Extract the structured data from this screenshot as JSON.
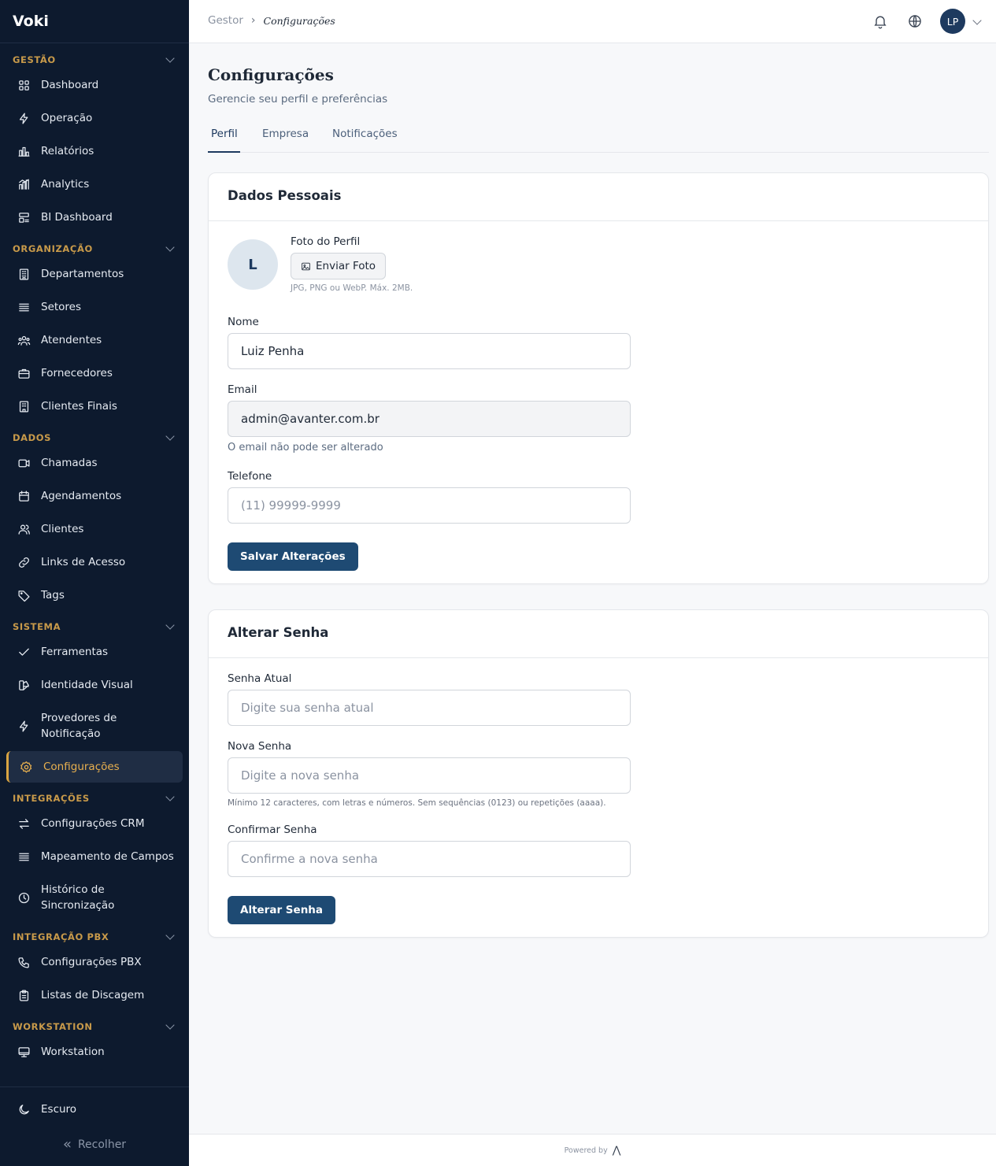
{
  "brand": "Voki",
  "sidebar": {
    "sections": [
      {
        "title": "GESTÃO",
        "items": [
          "Dashboard",
          "Operação",
          "Relatórios",
          "Analytics",
          "BI Dashboard"
        ]
      },
      {
        "title": "ORGANIZAÇÃO",
        "items": [
          "Departamentos",
          "Setores",
          "Atendentes",
          "Fornecedores",
          "Clientes Finais"
        ]
      },
      {
        "title": "DADOS",
        "items": [
          "Chamadas",
          "Agendamentos",
          "Clientes",
          "Links de Acesso",
          "Tags"
        ]
      },
      {
        "title": "SISTEMA",
        "items": [
          "Ferramentas",
          "Identidade Visual",
          "Provedores de Notificação",
          "Configurações"
        ]
      },
      {
        "title": "INTEGRAÇÕES",
        "items": [
          "Configurações CRM",
          "Mapeamento de Campos",
          "Histórico de Sincronização"
        ]
      },
      {
        "title": "INTEGRAÇÃO PBX",
        "items": [
          "Configurações PBX",
          "Listas de Discagem"
        ]
      },
      {
        "title": "WORKSTATION",
        "items": [
          "Workstation"
        ]
      }
    ],
    "active_item": "Configurações",
    "theme_toggle": "Escuro",
    "collapse_label": "Recolher"
  },
  "topbar": {
    "breadcrumb": [
      "Gestor",
      "Configurações"
    ],
    "avatar_initials": "LP"
  },
  "page": {
    "title": "Configurações",
    "subtitle": "Gerencie seu perfil e preferências",
    "tabs": [
      "Perfil",
      "Empresa",
      "Notificações"
    ],
    "active_tab": "Perfil"
  },
  "personal": {
    "heading": "Dados Pessoais",
    "avatar_letter": "L",
    "photo_label": "Foto do Perfil",
    "upload_label": "Enviar Foto",
    "photo_hint": "JPG, PNG ou WebP. Máx. 2MB.",
    "name_label": "Nome",
    "name_value": "Luiz Penha",
    "email_label": "Email",
    "email_value": "admin@avanter.com.br",
    "email_hint": "O email não pode ser alterado",
    "phone_label": "Telefone",
    "phone_placeholder": "(11) 99999-9999",
    "save_label": "Salvar Alterações"
  },
  "password": {
    "heading": "Alterar Senha",
    "current_label": "Senha Atual",
    "current_placeholder": "Digite sua senha atual",
    "new_label": "Nova Senha",
    "new_placeholder": "Digite a nova senha",
    "new_hint": "Mínimo 12 caracteres, com letras e números. Sem sequências (0123) ou repetições (aaaa).",
    "confirm_label": "Confirmar Senha",
    "confirm_placeholder": "Confirme a nova senha",
    "submit_label": "Alterar Senha"
  },
  "footer": {
    "powered_by": "Powered by"
  },
  "icons": {
    "Dashboard": "grid-icon",
    "Operação": "bolt-icon",
    "Relatórios": "bar-chart-icon",
    "Analytics": "analytics-icon",
    "BI Dashboard": "bi-icon",
    "Departamentos": "building-icon",
    "Setores": "list-icon",
    "Atendentes": "users-icon",
    "Fornecedores": "briefcase-icon",
    "Clientes Finais": "building2-icon",
    "Chamadas": "video-icon",
    "Agendamentos": "calendar-icon",
    "Clientes": "user-group-icon",
    "Links de Acesso": "link-icon",
    "Tags": "tag-icon",
    "Ferramentas": "check-icon",
    "Identidade Visual": "palette-icon",
    "Provedores de Notificação": "bolt-icon",
    "Configurações": "gear-icon",
    "Configurações CRM": "swap-icon",
    "Mapeamento de Campos": "list-icon",
    "Histórico de Sincronização": "clock-icon",
    "Configurações PBX": "phone-icon",
    "Listas de Discagem": "clipboard-icon",
    "Workstation": "monitor-icon"
  },
  "colors": {
    "sidebar_bg": "#0d1a2e",
    "accent_gold": "#d9a441",
    "primary": "#1e4a73"
  }
}
